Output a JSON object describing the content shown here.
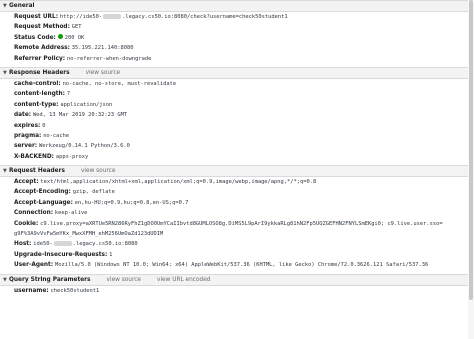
{
  "general": {
    "title": "General",
    "request_url_label": "Request URL:",
    "request_url_pre": "http://ide50-",
    "request_url_post": ".legacy.cs50.io:8080/check?username=check50student1",
    "request_method_label": "Request Method:",
    "request_method": "GET",
    "status_code_label": "Status Code:",
    "status_code": "200 OK",
    "remote_address_label": "Remote Address:",
    "remote_address": "35.195.221.140:8080",
    "referrer_policy_label": "Referrer Policy:",
    "referrer_policy": "no-referrer-when-downgrade"
  },
  "response_headers": {
    "title": "Response Headers",
    "view_source": "view source",
    "items": [
      {
        "key": "cache-control:",
        "value": "no-cache, no-store, must-revalidate"
      },
      {
        "key": "content-length:",
        "value": "7"
      },
      {
        "key": "content-type:",
        "value": "application/json"
      },
      {
        "key": "date:",
        "value": "Wed, 13 Mar 2019 20:32:23 GMT"
      },
      {
        "key": "expires:",
        "value": "0"
      },
      {
        "key": "pragma:",
        "value": "no-cache"
      },
      {
        "key": "server:",
        "value": "Werkzeug/0.14.1 Python/3.6.0"
      },
      {
        "key": "X-BACKEND:",
        "value": "apps-proxy"
      }
    ]
  },
  "request_headers": {
    "title": "Request Headers",
    "view_source": "view source",
    "accept_label": "Accept:",
    "accept": "text/html,application/xhtml+xml,application/xml;q=0.9,image/webp,image/apng,*/*;q=0.8",
    "accept_encoding_label": "Accept-Encoding:",
    "accept_encoding": "gzip, deflate",
    "accept_language_label": "Accept-Language:",
    "accept_language": "en,hu-HU;q=0.9,hu;q=0.8,en-US;q=0.7",
    "connection_label": "Connection:",
    "connection": "keep-alive",
    "cookie_label": "Cookie:",
    "cookie_1": "c9.live.proxy=aXRTUe5RN286RyFhZ1gDO0UmYCaIIbvtd8GUMLOSO8g.DiMS5L9pArI9ykkaRLg81hN2Fp5UQZGEFHN2FNYLSmEKgi0; c9.live.user.sso=",
    "cookie_2": "g9F%3A9vVvFw5mYKx_MwxXFMH_ehM256UmOaZd123dUDIM",
    "host_label": "Host:",
    "host_pre": "ide50-",
    "host_post": ".legacy.cs50.io:8080",
    "upgrade_label": "Upgrade-Insecure-Requests:",
    "upgrade": "1",
    "user_agent_label": "User-Agent:",
    "user_agent": "Mozilla/5.0 (Windows NT 10.0; Win64; x64) AppleWebKit/537.36 (KHTML, like Gecko) Chrome/72.0.3626.121 Safari/537.36"
  },
  "query_params": {
    "title": "Query String Parameters",
    "view_source": "view source",
    "view_url_encoded": "view URL encoded",
    "username_label": "username:",
    "username": "check50student1"
  },
  "colors": {
    "status_ok": "#0a9e01"
  }
}
